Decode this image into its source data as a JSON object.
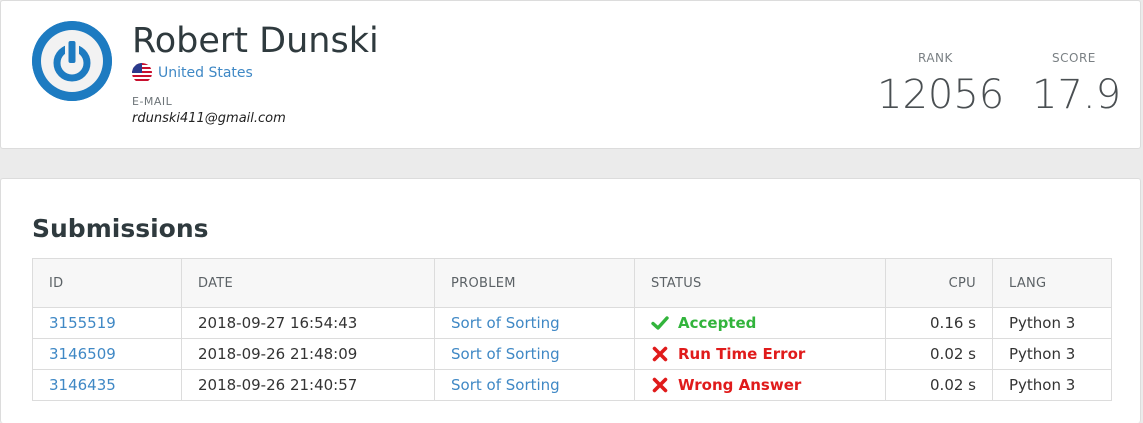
{
  "profile": {
    "name": "Robert Dunski",
    "country": "United States",
    "email_label": "E-MAIL",
    "email": "rdunski411@gmail.com",
    "avatar_icon": "power-icon",
    "flag_icon": "us-flag-icon",
    "rank_label": "RANK",
    "rank": "12056",
    "score_label": "SCORE",
    "score": "17.9"
  },
  "submissions": {
    "title": "Submissions",
    "columns": {
      "id": "ID",
      "date": "DATE",
      "problem": "PROBLEM",
      "status": "STATUS",
      "cpu": "CPU",
      "lang": "LANG"
    },
    "rows": [
      {
        "id": "3155519",
        "date": "2018-09-27 16:54:43",
        "problem": "Sort of Sorting",
        "status": "Accepted",
        "status_icon": "check-icon",
        "cpu": "0.16 s",
        "lang": "Python 3"
      },
      {
        "id": "3146509",
        "date": "2018-09-26 21:48:09",
        "problem": "Sort of Sorting",
        "status": "Run Time Error",
        "status_icon": "cross-icon",
        "cpu": "0.02 s",
        "lang": "Python 3"
      },
      {
        "id": "3146435",
        "date": "2018-09-26 21:40:57",
        "problem": "Sort of Sorting",
        "status": "Wrong Answer",
        "status_icon": "cross-icon",
        "cpu": "0.02 s",
        "lang": "Python 3"
      }
    ]
  },
  "colors": {
    "link": "#3f88c5",
    "accepted": "#32b43c",
    "error": "#e01b1b",
    "avatar": "#1d7bc1"
  }
}
